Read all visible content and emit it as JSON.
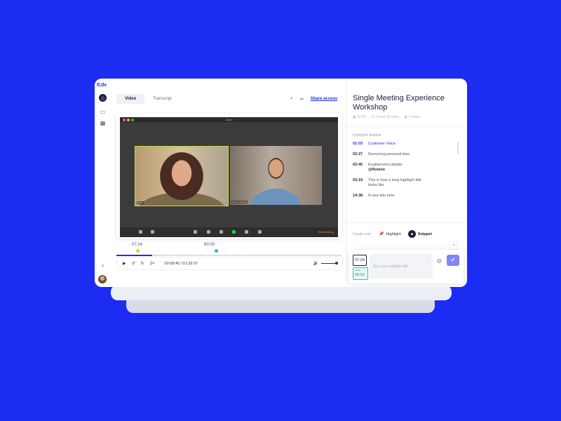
{
  "nav": {
    "logo": "tl;dv"
  },
  "tabs": [
    {
      "label": "Video"
    },
    {
      "label": "Transcript"
    }
  ],
  "toolbar": {
    "share_label": "Share access"
  },
  "video": {
    "window_title": "Zoom",
    "participants": [
      "Name",
      "Name Surname"
    ],
    "end_label": "End Meeting"
  },
  "timeline": {
    "markers": [
      {
        "time": "07:24",
        "color": "#f5c518"
      },
      {
        "time": "60:00",
        "color": "#22c6a5"
      }
    ],
    "progress": 0.16,
    "time_readout": "00:08:45 / 01:32:07",
    "speed": "2×"
  },
  "panel": {
    "title": "Single Meeting Experience Workshop",
    "meta": [
      "22.02",
      "1 hour 12 mins",
      "3 views"
    ],
    "highlights_heading": "Highlights timeline",
    "highlights": [
      {
        "time": "01:03",
        "title": "Customer Voice",
        "active": true
      },
      {
        "time": "02:27",
        "title": "Removing personal bias"
      },
      {
        "time": "02:45",
        "title": "Enablement Update",
        "mention": "@Ronnie"
      },
      {
        "time": "03:19",
        "title": "This is how a long highlight title looks like"
      },
      {
        "time": "14:38",
        "title": "A new title here"
      }
    ],
    "create_label": "Create new:",
    "highlight_option": "Highlight",
    "snippet_option": "Snippet",
    "editor": {
      "start": "07:24",
      "finish_label": "Finish",
      "finish": "60:00",
      "placeholder": "Type your highlight title"
    }
  },
  "colors": {
    "background": "#1d2cf3",
    "accent": "#1d2cf3",
    "dark": "#1c1f3c",
    "confirm": "#7f86f7"
  }
}
